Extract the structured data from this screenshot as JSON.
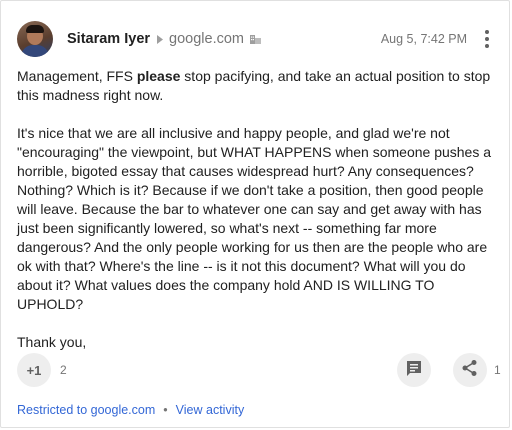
{
  "post": {
    "author": "Sitaram Iyer",
    "domain": "google.com",
    "timestamp": "Aug 5, 7:42 PM",
    "body": {
      "p1_before": "Management, FFS ",
      "p1_bold": "please",
      "p1_after": " stop pacifying, and take an actual position to stop this madness right now.",
      "p2": "It's nice that we are all inclusive and happy people, and glad we're not \"encouraging\" the viewpoint, but WHAT HAPPENS when someone pushes a horrible, bigoted essay that causes widespread hurt? Any consequences? Nothing? Which is it? Because if we don't take a position, then good people will leave. Because the bar to whatever one can say and get away with has just been significantly lowered, so what's next -- something far more dangerous? And the only people working for us then are the people who are ok with that? Where's the line -- is it not this document? What will you do about it? What values does the company hold AND IS WILLING TO UPHOLD?",
      "p3": "Thank you,"
    }
  },
  "actions": {
    "plus_one_label": "+1",
    "plus_one_count": "2",
    "comment_icon": "comment-icon",
    "share_icon": "share-icon",
    "share_count": "1"
  },
  "footer": {
    "restricted_label": "Restricted to google.com",
    "separator": "•",
    "activity_label": "View activity"
  },
  "colors": {
    "link": "#3367d6",
    "secondary_text": "#757575",
    "button_bg": "#eeeeee"
  }
}
